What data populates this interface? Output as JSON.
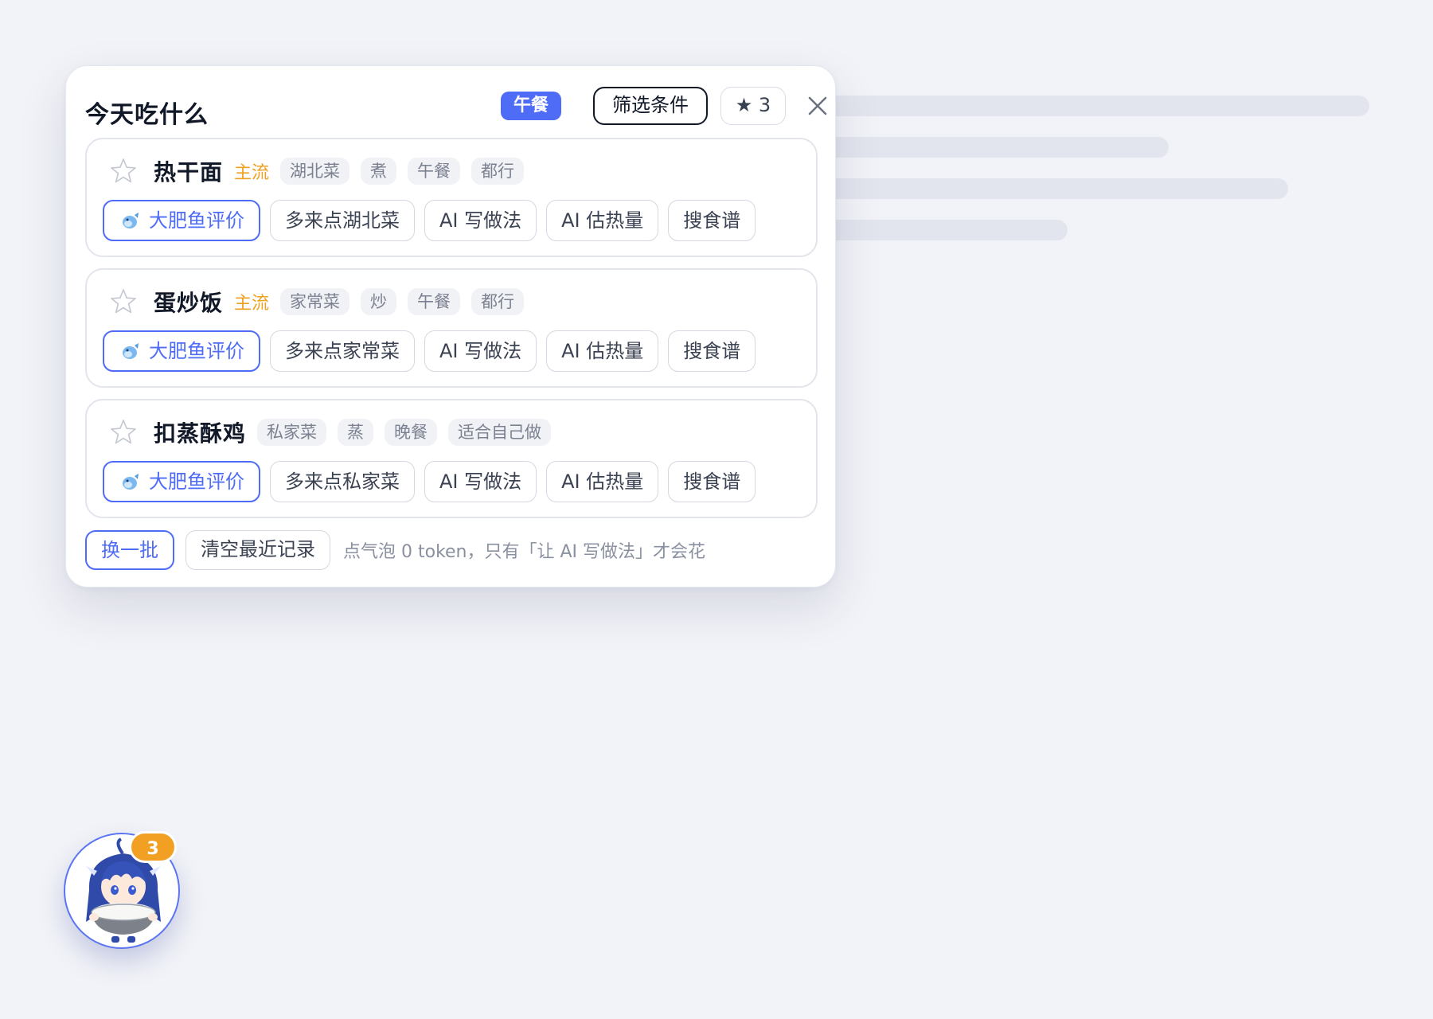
{
  "panel": {
    "title": "今天吃什么",
    "meal_badge": "午餐",
    "filter_label": "筛选条件",
    "favorites_label": "★ 3"
  },
  "dishes": [
    {
      "name": "热干面",
      "mainstream": "主流",
      "tags": [
        "湖北菜",
        "煮",
        "午餐",
        "都行"
      ],
      "actions": [
        "大肥鱼评价",
        "多来点湖北菜",
        "AI 写做法",
        "AI 估热量",
        "搜食谱"
      ]
    },
    {
      "name": "蛋炒饭",
      "mainstream": "主流",
      "tags": [
        "家常菜",
        "炒",
        "午餐",
        "都行"
      ],
      "actions": [
        "大肥鱼评价",
        "多来点家常菜",
        "AI 写做法",
        "AI 估热量",
        "搜食谱"
      ]
    },
    {
      "name": "扣蒸酥鸡",
      "mainstream": "",
      "tags": [
        "私家菜",
        "蒸",
        "晚餐",
        "适合自己做"
      ],
      "actions": [
        "大肥鱼评价",
        "多来点私家菜",
        "AI 写做法",
        "AI 估热量",
        "搜食谱"
      ]
    }
  ],
  "footer": {
    "refresh_label": "换一批",
    "clear_label": "清空最近记录",
    "note": "点气泡 0 token，只有「让 AI 写做法」才会花"
  },
  "avatar": {
    "badge_count": "3"
  },
  "icons": {
    "star": "star-outline-icon",
    "fish": "fish-icon",
    "close": "close-icon"
  },
  "colors": {
    "accent": "#4f6cf6",
    "mainstream": "#f0a020",
    "badge": "#f2a024"
  }
}
